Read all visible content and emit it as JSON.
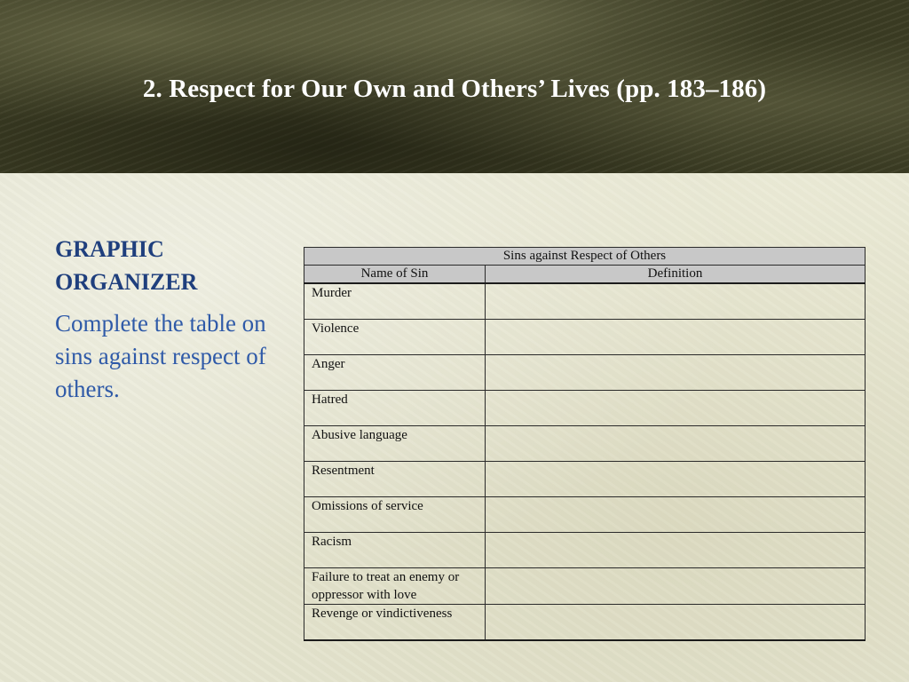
{
  "slide": {
    "title": "2. Respect for Our Own and Others’ Lives (pp. 183–186)"
  },
  "left_panel": {
    "heading_line1": "GRAPHIC",
    "heading_line2": "ORGANIZER",
    "instruction": "Complete the table on sins against respect of others."
  },
  "table": {
    "caption": "Sins against Respect of Others",
    "columns": [
      "Name of Sin",
      "Definition"
    ],
    "rows": [
      {
        "sin": "Murder",
        "definition": ""
      },
      {
        "sin": "Violence",
        "definition": ""
      },
      {
        "sin": "Anger",
        "definition": ""
      },
      {
        "sin": "Hatred",
        "definition": ""
      },
      {
        "sin": "Abusive language",
        "definition": ""
      },
      {
        "sin": "Resentment",
        "definition": ""
      },
      {
        "sin": "Omissions of service",
        "definition": ""
      },
      {
        "sin": "Racism",
        "definition": ""
      },
      {
        "sin": "Failure to treat an enemy or oppressor with love",
        "definition": ""
      },
      {
        "sin": "Revenge or vindictiveness",
        "definition": ""
      }
    ]
  },
  "colors": {
    "title_text": "#ffffff",
    "heading_text": "#1f3f7d",
    "body_text": "#2f5aa8",
    "table_header_fill": "#c8c8c8"
  }
}
